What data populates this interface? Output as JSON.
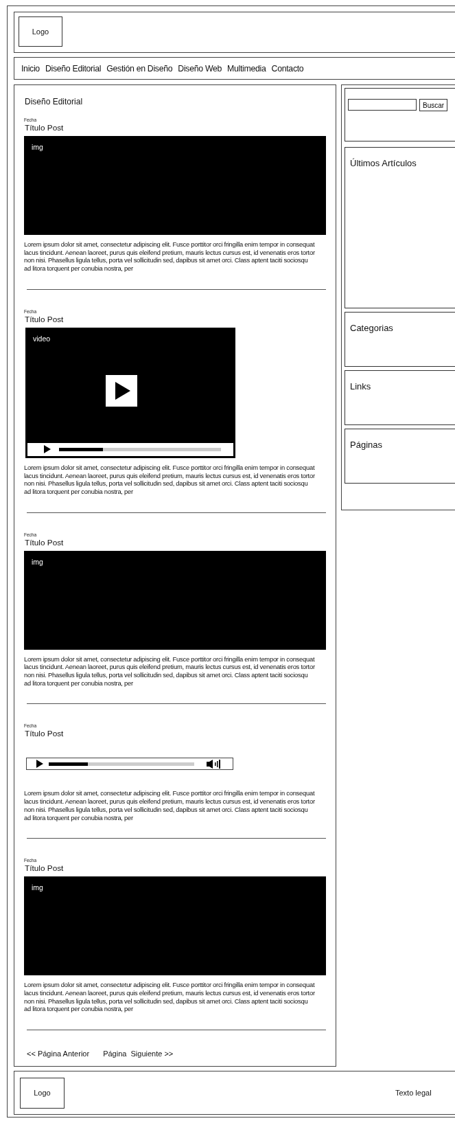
{
  "header": {
    "logo": "Logo"
  },
  "nav": [
    {
      "label": "Inicio"
    },
    {
      "label": "Diseño Editorial"
    },
    {
      "label": "Gestión en Diseño"
    },
    {
      "label": "Diseño Web"
    },
    {
      "label": "Multimedia"
    },
    {
      "label": "Contacto"
    }
  ],
  "main": {
    "section_title": "Diseño Editorial",
    "posts": [
      {
        "kind": "image",
        "date": "Fecha",
        "title": "Título Post",
        "media_label": "img",
        "text": "Lorem ipsum dolor sit amet, consectetur adipiscing elit. Fusce porttitor orci fringilla enim tempor in consequat lacus tincidunt. Aenean laoreet, purus quis eleifend pretium, mauris lectus cursus est, id venenatis eros tortor non nisi. Phasellus ligula tellus, porta vel sollicitudin sed, dapibus sit amet orci. Class aptent taciti sociosqu ad litora torquent per conubia nostra, per"
      },
      {
        "kind": "video",
        "date": "Fecha",
        "title": "Título Post",
        "media_label": "video",
        "level": 0.27,
        "text": "Lorem ipsum dolor sit amet, consectetur adipiscing elit. Fusce porttitor orci fringilla enim tempor in consequat lacus tincidunt. Aenean laoreet, purus quis eleifend pretium, mauris lectus cursus est, id venenatis eros tortor non nisi. Phasellus ligula tellus, porta vel sollicitudin sed, dapibus sit amet orci. Class aptent taciti sociosqu ad litora torquent per conubia nostra, per"
      },
      {
        "kind": "image",
        "date": "Fecha",
        "title": "Título Post",
        "media_label": "img",
        "text": "Lorem ipsum dolor sit amet, consectetur adipiscing elit. Fusce porttitor orci fringilla enim tempor in consequat lacus tincidunt. Aenean laoreet, purus quis eleifend pretium, mauris lectus cursus est, id venenatis eros tortor non nisi. Phasellus ligula tellus, porta vel sollicitudin sed, dapibus sit amet orci. Class aptent taciti sociosqu ad litora torquent per conubia nostra, per"
      },
      {
        "kind": "audio",
        "date": "Fecha",
        "title": "Título Post",
        "level": 0.27,
        "text": "Lorem ipsum dolor sit amet, consectetur adipiscing elit. Fusce porttitor orci fringilla enim tempor in consequat lacus tincidunt. Aenean laoreet, purus quis eleifend pretium, mauris lectus cursus est, id venenatis eros tortor non nisi. Phasellus ligula tellus, porta vel sollicitudin sed, dapibus sit amet orci. Class aptent taciti sociosqu ad litora torquent per conubia nostra, per"
      },
      {
        "kind": "image",
        "date": "Fecha",
        "title": "Título Post",
        "media_label": "img",
        "text": "Lorem ipsum dolor sit amet, consectetur adipiscing elit. Fusce porttitor orci fringilla enim tempor in consequat lacus tincidunt. Aenean laoreet, purus quis eleifend pretium, mauris lectus cursus est, id venenatis eros tortor non nisi. Phasellus ligula tellus, porta vel sollicitudin sed, dapibus sit amet orci. Class aptent taciti sociosqu ad litora torquent per conubia nostra, per"
      }
    ],
    "pagination": {
      "previous": "<< Página Anterior",
      "next": "Página  Siguiente >>"
    }
  },
  "sidebar": {
    "search_button": "Buscar",
    "widgets": [
      {
        "title": "Últimos Artículos"
      },
      {
        "title": "Categorias"
      },
      {
        "title": "Links"
      },
      {
        "title": "Páginas"
      }
    ]
  },
  "footer": {
    "logo": "Logo",
    "legal": "Texto legal"
  }
}
